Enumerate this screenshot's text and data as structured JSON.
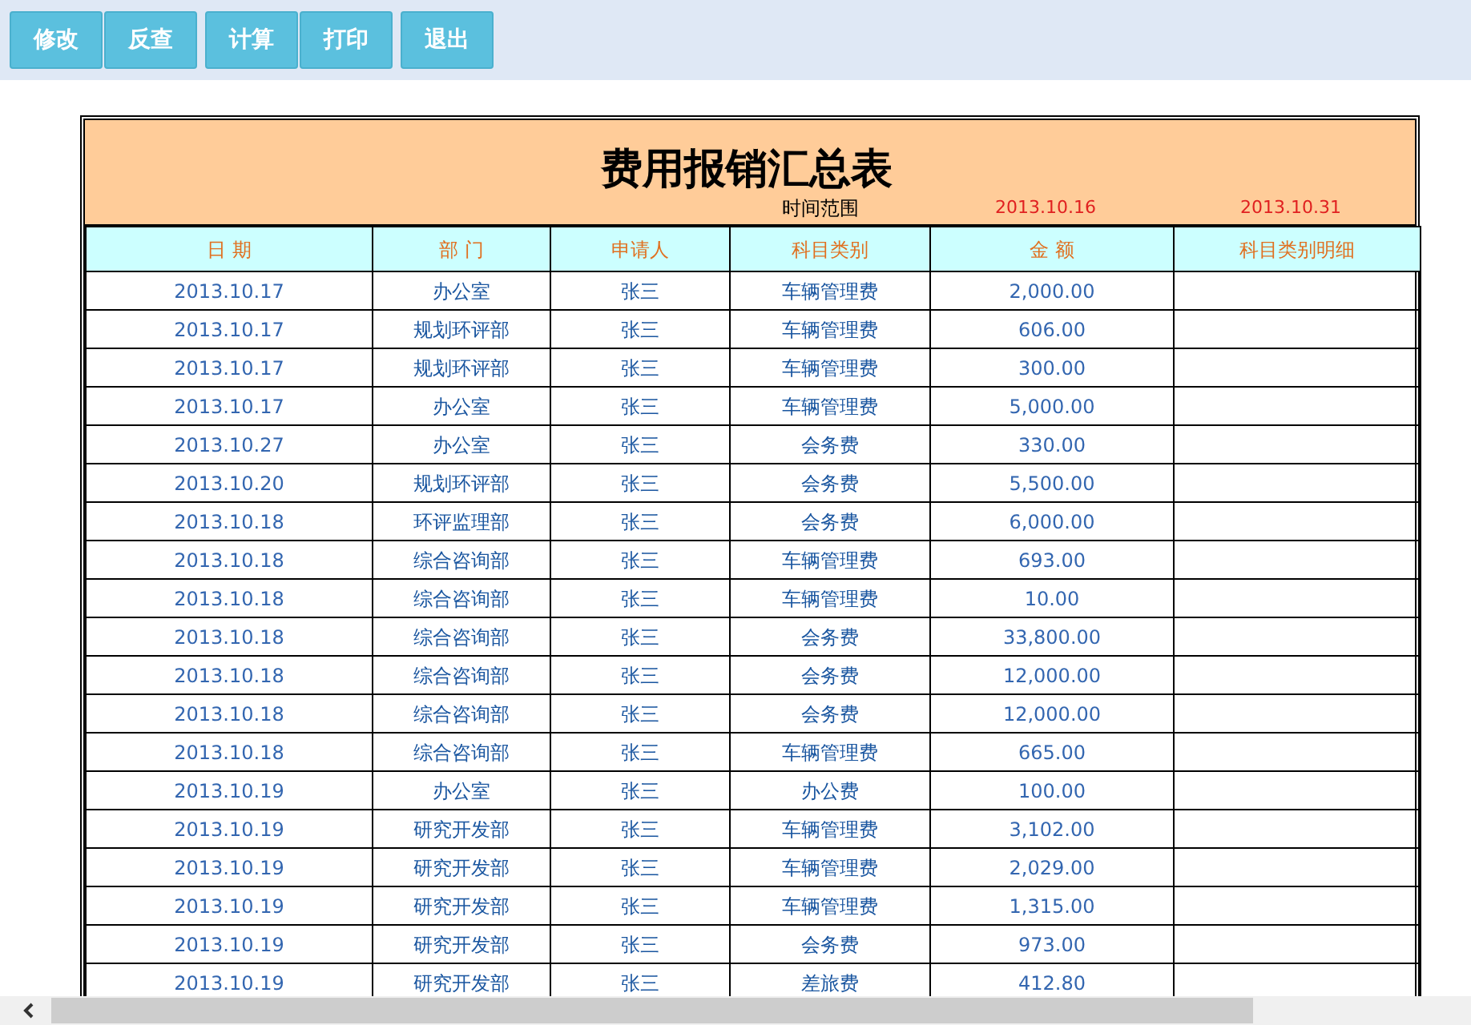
{
  "toolbar": {
    "button_groups": [
      [
        "修改",
        "反查"
      ],
      [
        "计算",
        "打印"
      ],
      [
        "退出"
      ]
    ]
  },
  "report": {
    "title": "费用报销汇总表",
    "range_label": "时间范围",
    "range_start": "2013.10.16",
    "range_end": "2013.10.31",
    "columns": [
      "日 期",
      "部 门",
      "申请人",
      "科目类别",
      "金 额",
      "科目类别明细"
    ],
    "rows": [
      [
        "2013.10.17",
        "办公室",
        "张三",
        "车辆管理费",
        "2,000.00"
      ],
      [
        "2013.10.17",
        "规划环评部",
        "张三",
        "车辆管理费",
        "606.00"
      ],
      [
        "2013.10.17",
        "规划环评部",
        "张三",
        "车辆管理费",
        "300.00"
      ],
      [
        "2013.10.17",
        "办公室",
        "张三",
        "车辆管理费",
        "5,000.00"
      ],
      [
        "2013.10.27",
        "办公室",
        "张三",
        "会务费",
        "330.00"
      ],
      [
        "2013.10.20",
        "规划环评部",
        "张三",
        "会务费",
        "5,500.00"
      ],
      [
        "2013.10.18",
        "环评监理部",
        "张三",
        "会务费",
        "6,000.00"
      ],
      [
        "2013.10.18",
        "综合咨询部",
        "张三",
        "车辆管理费",
        "693.00"
      ],
      [
        "2013.10.18",
        "综合咨询部",
        "张三",
        "车辆管理费",
        "10.00"
      ],
      [
        "2013.10.18",
        "综合咨询部",
        "张三",
        "会务费",
        "33,800.00"
      ],
      [
        "2013.10.18",
        "综合咨询部",
        "张三",
        "会务费",
        "12,000.00"
      ],
      [
        "2013.10.18",
        "综合咨询部",
        "张三",
        "会务费",
        "12,000.00"
      ],
      [
        "2013.10.18",
        "综合咨询部",
        "张三",
        "车辆管理费",
        "665.00"
      ],
      [
        "2013.10.19",
        "办公室",
        "张三",
        "办公费",
        "100.00"
      ],
      [
        "2013.10.19",
        "研究开发部",
        "张三",
        "车辆管理费",
        "3,102.00"
      ],
      [
        "2013.10.19",
        "研究开发部",
        "张三",
        "车辆管理费",
        "2,029.00"
      ],
      [
        "2013.10.19",
        "研究开发部",
        "张三",
        "车辆管理费",
        "1,315.00"
      ],
      [
        "2013.10.19",
        "研究开发部",
        "张三",
        "会务费",
        "973.00"
      ],
      [
        "2013.10.19",
        "研究开发部",
        "张三",
        "差旅费",
        "412.80"
      ]
    ]
  }
}
